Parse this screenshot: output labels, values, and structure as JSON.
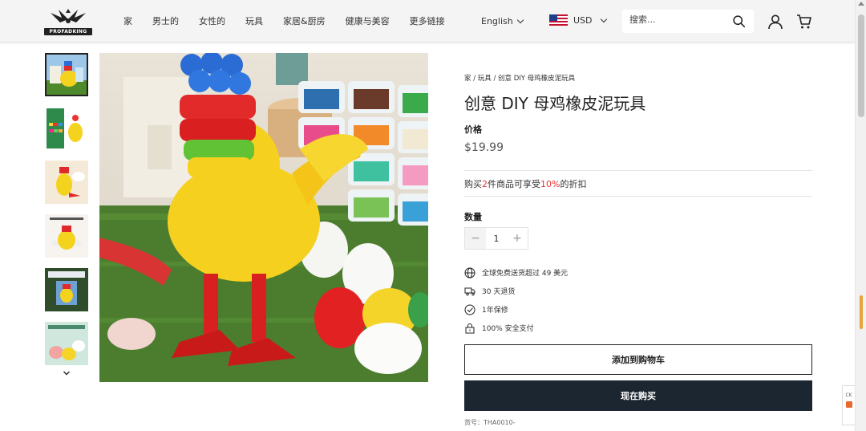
{
  "header": {
    "logo_text": "PROFADKING",
    "nav": [
      "家",
      "男士的",
      "女性的",
      "玩具",
      "家居&厨房",
      "健康与美容",
      "更多链接"
    ],
    "language": "English",
    "currency": "USD",
    "search_placeholder": "搜索..."
  },
  "product": {
    "breadcrumb": "家 / 玩具 / 创意 DIY 母鸡橡皮泥玩具",
    "title": "创意 DIY 母鸡橡皮泥玩具",
    "price_label": "价格",
    "price": "$19.99",
    "promo": {
      "prefix": "购买",
      "qty": "2",
      "middle": "件商品可享受",
      "discount": "10%",
      "suffix": "的折扣"
    },
    "quantity_label": "数量",
    "quantity": "1",
    "features": [
      {
        "icon": "globe-icon",
        "text": "全球免费送货超过 49 美元"
      },
      {
        "icon": "truck-icon",
        "text": "30 天退货"
      },
      {
        "icon": "check-circle-icon",
        "text": "1年保修"
      },
      {
        "icon": "lock-icon",
        "text": "100% 安全支付"
      }
    ],
    "add_to_cart": "添加到购物车",
    "buy_now": "现在购买",
    "sku": "货号：THA0010-"
  },
  "side_widget": {
    "text": "CK"
  },
  "colors": {
    "buy_button": "#1c2631",
    "promo_red": "#e53030",
    "header_bg": "#f4f4f4"
  }
}
